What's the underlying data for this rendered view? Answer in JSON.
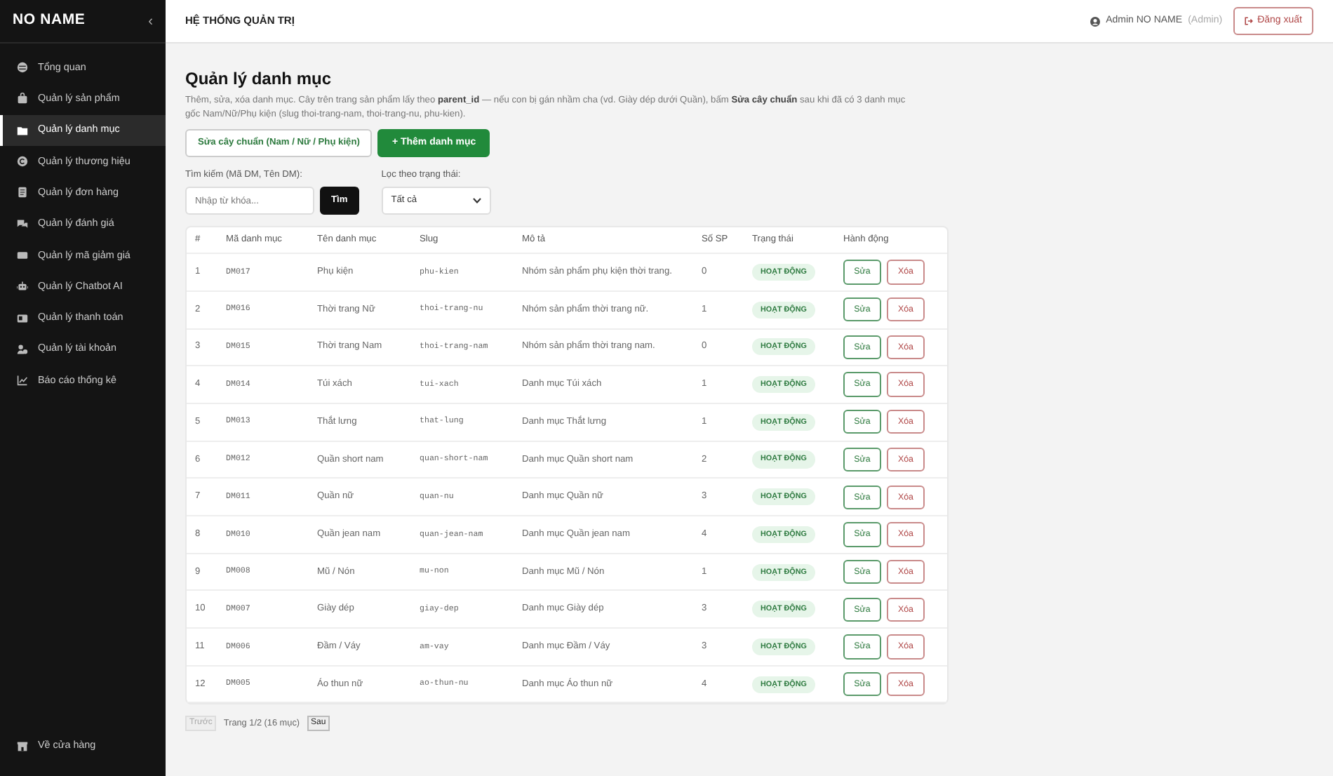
{
  "sidebar": {
    "brand": "NO NAME",
    "collapse": "‹",
    "items": [
      {
        "label": "Tổng quan",
        "selected": false
      },
      {
        "label": "Quản lý sản phẩm",
        "selected": false
      },
      {
        "label": "Quản lý danh mục",
        "selected": true
      },
      {
        "label": "Quản lý thương hiệu",
        "selected": false
      },
      {
        "label": "Quản lý đơn hàng",
        "selected": false
      },
      {
        "label": "Quản lý đánh giá",
        "selected": false
      },
      {
        "label": "Quản lý mã giảm giá",
        "selected": false
      },
      {
        "label": "Quản lý Chatbot AI",
        "selected": false
      },
      {
        "label": "Quản lý thanh toán",
        "selected": false
      },
      {
        "label": "Quản lý tài khoản",
        "selected": false
      },
      {
        "label": "Báo cáo thống kê",
        "selected": false
      }
    ],
    "footer": "Về cửa hàng"
  },
  "topbar": {
    "title": "HỆ THỐNG QUẢN TRỊ",
    "user": "Admin NO NAME",
    "role": "(Admin)",
    "logout": "Đăng xuất"
  },
  "page": {
    "title": "Quản lý danh mục",
    "description": "Thêm, sửa, xóa danh mục. Cây trên trang sản phẩm lấy theo **parent_id** — nếu con bị gán nhầm cha (vd. Giày dép dưới Quần), bấm **Sửa cây chuẩn** sau khi đã có 3 danh mục gốc Nam/Nữ/Phụ kiện (slug thoi-trang-nam, thoi-trang-nu, phu-kien).",
    "buttons": [
      "Sửa cây chuẩn (Nam / Nữ / Phụ kiện)",
      "+ Thêm danh mục"
    ]
  },
  "filters": {
    "search_label": "Tìm kiếm (Mã DM, Tên DM):",
    "search_placeholder": "Nhập từ khóa...",
    "search_button": "Tìm",
    "status_label": "Lọc theo trạng thái:",
    "status_value": "Tất cả"
  },
  "table": {
    "columns": [
      "#",
      "Mã danh mục",
      "Tên danh mục",
      "Slug",
      "Mô tả",
      "Số SP",
      "Trạng thái",
      "Hành động"
    ],
    "rows": [
      {
        "index": "1",
        "code": "DM017",
        "name": "Phụ kiện",
        "slug": "phu-kien",
        "description": "Nhóm sản phẩm phụ kiện thời trang.",
        "count": "0",
        "status": "HOẠT ĐỘNG",
        "edit": "Sửa",
        "delete": "Xóa"
      },
      {
        "index": "2",
        "code": "DM016",
        "name": "Thời trang Nữ",
        "slug": "thoi-trang-nu",
        "description": "Nhóm sản phẩm thời trang nữ.",
        "count": "1",
        "status": "HOẠT ĐỘNG",
        "edit": "Sửa",
        "delete": "Xóa"
      },
      {
        "index": "3",
        "code": "DM015",
        "name": "Thời trang Nam",
        "slug": "thoi-trang-nam",
        "description": "Nhóm sản phẩm thời trang nam.",
        "count": "0",
        "status": "HOẠT ĐỘNG",
        "edit": "Sửa",
        "delete": "Xóa"
      },
      {
        "index": "4",
        "code": "DM014",
        "name": "Túi xách",
        "slug": "tui-xach",
        "description": "Danh mục Túi xách",
        "count": "1",
        "status": "HOẠT ĐỘNG",
        "edit": "Sửa",
        "delete": "Xóa"
      },
      {
        "index": "5",
        "code": "DM013",
        "name": "Thắt lưng",
        "slug": "that-lung",
        "description": "Danh mục Thắt lưng",
        "count": "1",
        "status": "HOẠT ĐỘNG",
        "edit": "Sửa",
        "delete": "Xóa"
      },
      {
        "index": "6",
        "code": "DM012",
        "name": "Quần short nam",
        "slug": "quan-short-nam",
        "description": "Danh mục Quần short nam",
        "count": "2",
        "status": "HOẠT ĐỘNG",
        "edit": "Sửa",
        "delete": "Xóa"
      },
      {
        "index": "7",
        "code": "DM011",
        "name": "Quần nữ",
        "slug": "quan-nu",
        "description": "Danh mục Quần nữ",
        "count": "3",
        "status": "HOẠT ĐỘNG",
        "edit": "Sửa",
        "delete": "Xóa"
      },
      {
        "index": "8",
        "code": "DM010",
        "name": "Quần jean nam",
        "slug": "quan-jean-nam",
        "description": "Danh mục Quần jean nam",
        "count": "4",
        "status": "HOẠT ĐỘNG",
        "edit": "Sửa",
        "delete": "Xóa"
      },
      {
        "index": "9",
        "code": "DM008",
        "name": "Mũ / Nón",
        "slug": "mu-non",
        "description": "Danh mục Mũ / Nón",
        "count": "1",
        "status": "HOẠT ĐỘNG",
        "edit": "Sửa",
        "delete": "Xóa"
      },
      {
        "index": "10",
        "code": "DM007",
        "name": "Giày dép",
        "slug": "giay-dep",
        "description": "Danh mục Giày dép",
        "count": "3",
        "status": "HOẠT ĐỘNG",
        "edit": "Sửa",
        "delete": "Xóa"
      },
      {
        "index": "11",
        "code": "DM006",
        "name": "Đầm / Váy",
        "slug": "am-vay",
        "description": "Danh mục Đầm / Váy",
        "count": "3",
        "status": "HOẠT ĐỘNG",
        "edit": "Sửa",
        "delete": "Xóa"
      },
      {
        "index": "12",
        "code": "DM005",
        "name": "Áo thun nữ",
        "slug": "ao-thun-nu",
        "description": "Danh mục Áo thun nữ",
        "count": "4",
        "status": "HOẠT ĐỘNG",
        "edit": "Sửa",
        "delete": "Xóa"
      }
    ]
  },
  "pagination": {
    "prev": "Trước",
    "prev_disabled": true,
    "info": "Trang 1/2 (16 mục)",
    "next": "Sau",
    "next_disabled": false
  }
}
